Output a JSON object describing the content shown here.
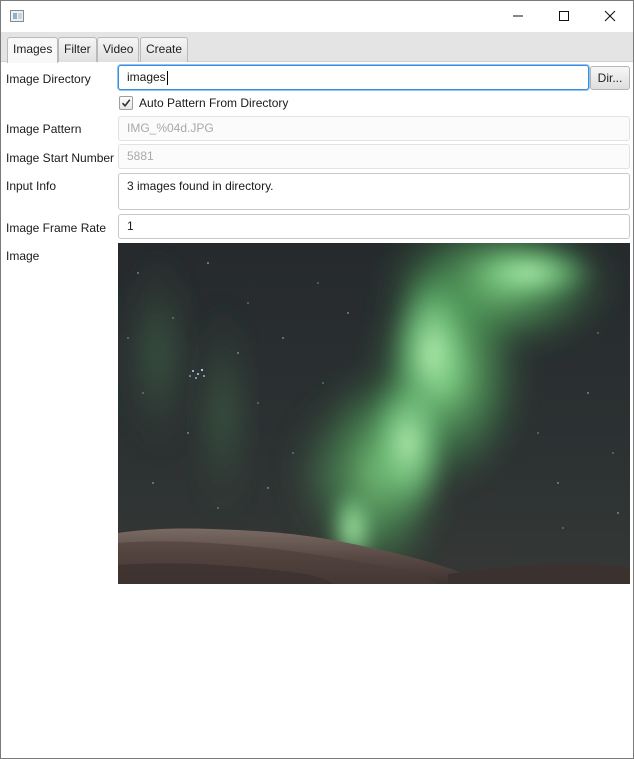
{
  "window": {
    "app_icon": "app-icon",
    "controls": {
      "minimize_icon": "minimize-icon",
      "maximize_icon": "maximize-icon",
      "close_icon": "close-icon"
    }
  },
  "tabs": [
    {
      "label": "Images",
      "active": true
    },
    {
      "label": "Filter",
      "active": false
    },
    {
      "label": "Video",
      "active": false
    },
    {
      "label": "Create",
      "active": false
    }
  ],
  "form": {
    "image_directory": {
      "label": "Image Directory",
      "value": "images",
      "button_label": "Dir..."
    },
    "auto_pattern": {
      "label": "Auto Pattern From Directory",
      "checked": true
    },
    "image_pattern": {
      "label": "Image Pattern",
      "value": "IMG_%04d.JPG"
    },
    "image_start_number": {
      "label": "Image Start Number",
      "value": "5881"
    },
    "input_info": {
      "label": "Input Info",
      "value": "3 images found in directory."
    },
    "image_frame_rate": {
      "label": "Image Frame Rate",
      "value": "1"
    },
    "image": {
      "label": "Image",
      "preview": "aurora-night-sky-photo"
    }
  },
  "colors": {
    "focus_border": "#3a8dde",
    "tab_bar_bg": "#e4e4e4",
    "disabled_text": "#a9a9a9"
  }
}
